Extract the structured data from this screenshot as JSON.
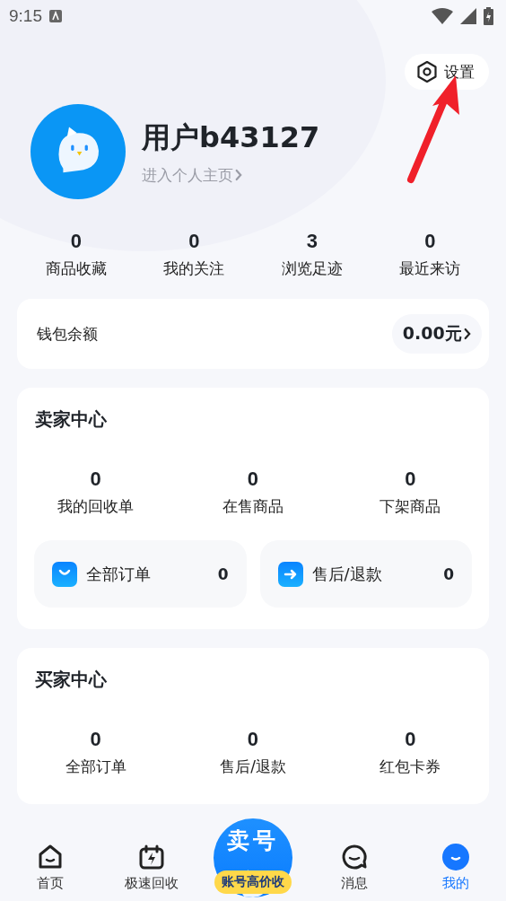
{
  "status_bar": {
    "time": "9:15"
  },
  "settings_button": {
    "label": "设置"
  },
  "profile": {
    "name": "用户b43127",
    "link": "进入个人主页"
  },
  "stats": [
    {
      "value": "0",
      "label": "商品收藏"
    },
    {
      "value": "0",
      "label": "我的关注"
    },
    {
      "value": "3",
      "label": "浏览足迹"
    },
    {
      "value": "0",
      "label": "最近来访"
    }
  ],
  "wallet": {
    "label": "钱包余额",
    "amount": "0.00元"
  },
  "seller_center": {
    "title": "卖家中心",
    "stats": [
      {
        "value": "0",
        "label": "我的回收单"
      },
      {
        "value": "0",
        "label": "在售商品"
      },
      {
        "value": "0",
        "label": "下架商品"
      }
    ],
    "shortcuts": [
      {
        "kind": "bag",
        "label": "全部订单",
        "count": "0"
      },
      {
        "kind": "arrow",
        "label": "售后/退款",
        "count": "0"
      }
    ]
  },
  "buyer_center": {
    "title": "买家中心",
    "stats": [
      {
        "value": "0",
        "label": "全部订单"
      },
      {
        "value": "0",
        "label": "售后/退款"
      },
      {
        "value": "0",
        "label": "红包卡券"
      }
    ]
  },
  "tab_bar": {
    "items": [
      {
        "kind": "home",
        "label": "首页",
        "selected": false
      },
      {
        "kind": "recycle",
        "label": "极速回收",
        "selected": false
      },
      {
        "kind": "center",
        "title": "卖号",
        "label": "账号高价收",
        "selected": false
      },
      {
        "kind": "message",
        "label": "消息",
        "selected": false
      },
      {
        "kind": "me",
        "label": "我的",
        "selected": true
      }
    ]
  }
}
